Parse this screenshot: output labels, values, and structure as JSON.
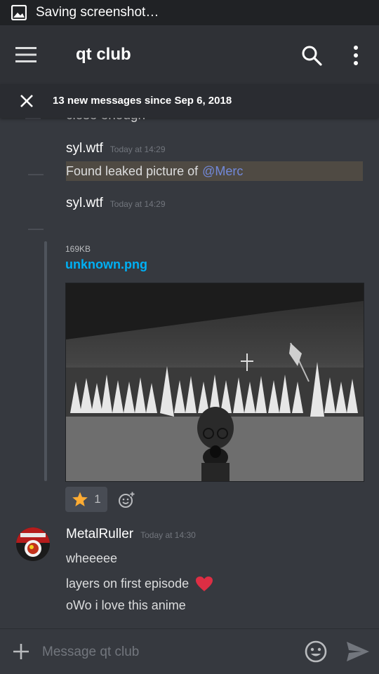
{
  "statusbar": {
    "text": "Saving screenshot…"
  },
  "appbar": {
    "title": "qt club"
  },
  "newbar": {
    "text": "13 new messages since Sep 6, 2018"
  },
  "messages": [
    {
      "text": "close enough"
    },
    {
      "author": "syl.wtf",
      "time": "Today at 14:29",
      "text": "Found leaked picture of",
      "mention": "@Merc"
    },
    {
      "author": "syl.wtf",
      "time": "Today at 14:29",
      "attachment": {
        "size": "169KB",
        "filename": "unknown.png"
      },
      "reaction": {
        "emoji": "star",
        "count": "1"
      }
    },
    {
      "author": "MetalRuller",
      "time": "Today at 14:30",
      "lines": [
        "wheeeee",
        "layers on first episode",
        "oWo i love this anime"
      ]
    }
  ],
  "composer": {
    "placeholder": "Message qt club"
  },
  "colors": {
    "background": "#36393f",
    "mention": "#7289da",
    "link": "#00b0f4",
    "heart": "#dd2e44",
    "star": "#ffac33"
  },
  "icons": [
    "image-icon",
    "menu-icon",
    "search-icon",
    "more-vert-icon",
    "close-icon",
    "star-emoji-icon",
    "add-reaction-icon",
    "heart-emoji-icon",
    "plus-icon",
    "emoji-icon",
    "send-icon"
  ]
}
